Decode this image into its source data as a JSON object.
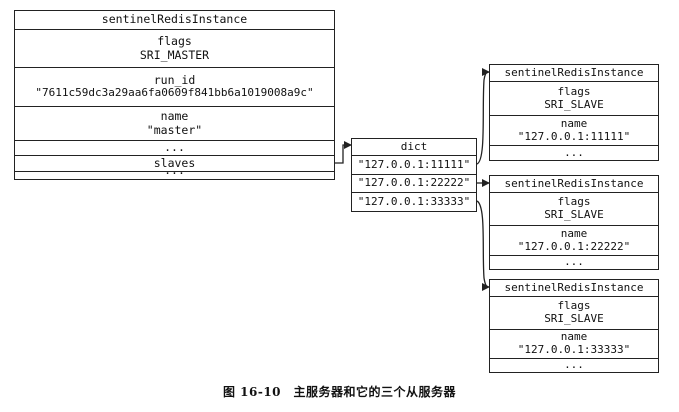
{
  "master": {
    "header": "sentinelRedisInstance",
    "flags_label": "flags",
    "flags_value": "SRI_MASTER",
    "run_id_label": "run_id",
    "run_id_value": "\"7611c59dc3a29aa6fa0609f841bb6a1019008a9c\"",
    "name_label": "name",
    "name_value": "\"master\"",
    "ellipsis1": "...",
    "slaves_label": "slaves",
    "ellipsis2": "..."
  },
  "dict": {
    "header": "dict",
    "keys": [
      "\"127.0.0.1:11111\"",
      "\"127.0.0.1:22222\"",
      "\"127.0.0.1:33333\""
    ]
  },
  "slaves": [
    {
      "header": "sentinelRedisInstance",
      "flags_label": "flags",
      "flags_value": "SRI_SLAVE",
      "name_label": "name",
      "name_value": "\"127.0.0.1:11111\"",
      "ellipsis": "..."
    },
    {
      "header": "sentinelRedisInstance",
      "flags_label": "flags",
      "flags_value": "SRI_SLAVE",
      "name_label": "name",
      "name_value": "\"127.0.0.1:22222\"",
      "ellipsis": "..."
    },
    {
      "header": "sentinelRedisInstance",
      "flags_label": "flags",
      "flags_value": "SRI_SLAVE",
      "name_label": "name",
      "name_value": "\"127.0.0.1:33333\"",
      "ellipsis": "..."
    }
  ],
  "caption": "图 16-10　主服务器和它的三个从服务器"
}
